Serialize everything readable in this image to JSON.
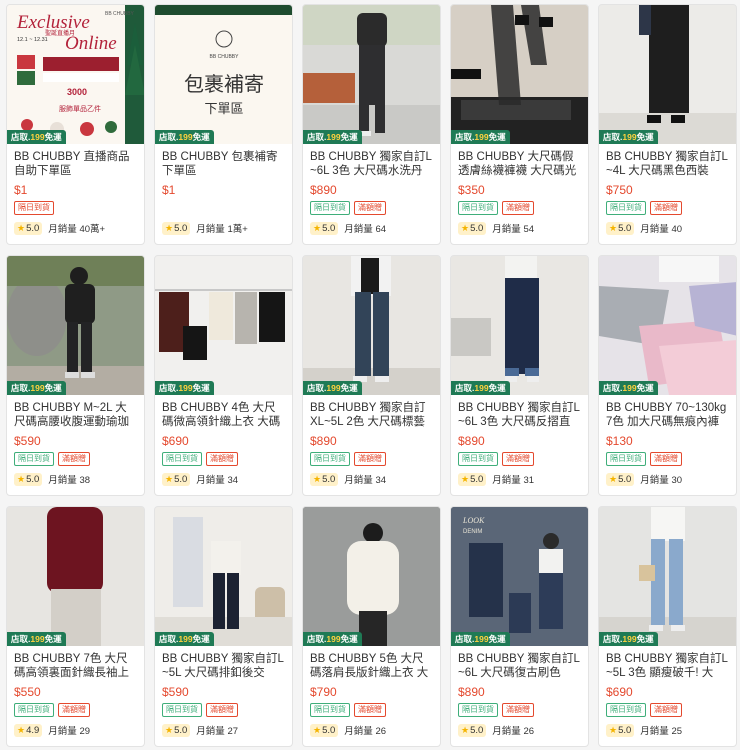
{
  "products": [
    {
      "title": "BB CHUBBY 直播商品自助下單區",
      "price": "$1",
      "rating": "5.0",
      "sold_label": "月銷量",
      "sold": "40萬+",
      "badge_prefix": "店取.",
      "badge_num": "199",
      "badge_suffix": "免運",
      "tags": [
        "隔日到貨"
      ],
      "banner": {
        "heading": "Exclusive",
        "heading2": "Online",
        "brand": "BB CHUBBY",
        "line1": "聖誕直播月",
        "dates": "12.1 ~ 12.31",
        "line2": "購滿",
        "amount": "3000",
        "line3": "服飾單品乙件"
      }
    },
    {
      "title": "BB CHUBBY 包裹補寄下單區",
      "price": "$1",
      "rating": "5.0",
      "sold_label": "月銷量",
      "sold": "1萬+",
      "badge_prefix": "店取.",
      "badge_num": "199",
      "badge_suffix": "免運",
      "tags": [],
      "banner": {
        "brand": "BB CHUBBY",
        "heading": "包裹補寄",
        "sub": "下單區"
      }
    },
    {
      "title": "BB CHUBBY 獨家自訂L~6L 3色 大尺碼水洗丹寧...",
      "price": "$890",
      "rating": "5.0",
      "sold_label": "月銷量",
      "sold": "64",
      "badge_prefix": "店取.",
      "badge_num": "199",
      "badge_suffix": "免運",
      "tags": [
        "隔日到貨",
        "滿額贈"
      ]
    },
    {
      "title": "BB CHUBBY 大尺碼假透膚絲襪褲襪 大尺碼光腿神器...",
      "price": "$350",
      "rating": "5.0",
      "sold_label": "月銷量",
      "sold": "54",
      "badge_prefix": "店取.",
      "badge_num": "199",
      "badge_suffix": "免運",
      "tags": [
        "隔日到貨",
        "滿額贈"
      ]
    },
    {
      "title": "BB CHUBBY 獨家自訂L~4L 大尺碼黑色西裝長...",
      "price": "$750",
      "rating": "5.0",
      "sold_label": "月銷量",
      "sold": "40",
      "badge_prefix": "店取.",
      "badge_num": "199",
      "badge_suffix": "免運",
      "tags": [
        "隔日到貨",
        "滿額贈"
      ]
    },
    {
      "title": "BB CHUBBY M~2L 大尺碼高腰收腹運動瑜珈褲 大尺...",
      "price": "$590",
      "rating": "5.0",
      "sold_label": "月銷量",
      "sold": "38",
      "badge_prefix": "店取.",
      "badge_num": "199",
      "badge_suffix": "免運",
      "tags": [
        "隔日到貨",
        "滿額贈"
      ]
    },
    {
      "title": "BB CHUBBY 4色 大尺碼微高領針織上衣 大碼針織上...",
      "price": "$690",
      "rating": "5.0",
      "sold_label": "月銷量",
      "sold": "34",
      "badge_prefix": "店取.",
      "badge_num": "199",
      "badge_suffix": "免運",
      "tags": [
        "隔日到貨",
        "滿額贈"
      ]
    },
    {
      "title": "BB CHUBBY 獨家自訂XL~5L 2色 大尺碼標藝牛...",
      "price": "$890",
      "rating": "5.0",
      "sold_label": "月銷量",
      "sold": "34",
      "badge_prefix": "店取.",
      "badge_num": "199",
      "badge_suffix": "免運",
      "tags": [
        "隔日到貨",
        "滿額贈"
      ]
    },
    {
      "title": "BB CHUBBY 獨家自訂L~6L 3色 大尺碼反摺直筒...",
      "price": "$890",
      "rating": "5.0",
      "sold_label": "月銷量",
      "sold": "31",
      "badge_prefix": "店取.",
      "badge_num": "199",
      "badge_suffix": "免運",
      "tags": [
        "隔日到貨",
        "滿額贈"
      ]
    },
    {
      "title": "BB CHUBBY 70~130kg 7色 加大尺碼無痕內褲 大尺碼...",
      "price": "$130",
      "rating": "5.0",
      "sold_label": "月銷量",
      "sold": "30",
      "badge_prefix": "店取.",
      "badge_num": "199",
      "badge_suffix": "免運",
      "tags": [
        "隔日到貨",
        "滿額贈"
      ]
    },
    {
      "title": "BB CHUBBY 7色 大尺碼高領裏面針織長袖上衣 中大...",
      "price": "$550",
      "rating": "4.9",
      "sold_label": "月銷量",
      "sold": "29",
      "badge_prefix": "店取.",
      "badge_num": "199",
      "badge_suffix": "免運",
      "tags": [
        "隔日到貨",
        "滿額贈"
      ]
    },
    {
      "title": "BB CHUBBY 獨家自訂L~5L 大尺碼排釦後交叉...",
      "price": "$590",
      "rating": "5.0",
      "sold_label": "月銷量",
      "sold": "27",
      "badge_prefix": "店取.",
      "badge_num": "199",
      "badge_suffix": "免運",
      "tags": [
        "隔日到貨",
        "滿額贈"
      ]
    },
    {
      "title": "BB CHUBBY 5色 大尺碼落肩長版針織上衣 大尺碼寬...",
      "price": "$790",
      "rating": "5.0",
      "sold_label": "月銷量",
      "sold": "26",
      "badge_prefix": "店取.",
      "badge_num": "199",
      "badge_suffix": "免運",
      "tags": [
        "隔日到貨",
        "滿額贈"
      ]
    },
    {
      "title": "BB CHUBBY 獨家自訂L~6L 大尺碼復古刷色闊...",
      "price": "$890",
      "rating": "5.0",
      "sold_label": "月銷量",
      "sold": "26",
      "badge_prefix": "店取.",
      "badge_num": "199",
      "badge_suffix": "免運",
      "tags": [
        "隔日到貨",
        "滿額贈"
      ],
      "banner": {
        "heading": "LOOK",
        "sub": "DENIM"
      }
    },
    {
      "title": "BB CHUBBY 獨家自訂L~5L 3色 顯瘦破千! 大尺...",
      "price": "$690",
      "rating": "5.0",
      "sold_label": "月銷量",
      "sold": "25",
      "badge_prefix": "店取.",
      "badge_num": "199",
      "badge_suffix": "免運",
      "tags": [
        "隔日到貨",
        "滿額贈"
      ]
    }
  ]
}
